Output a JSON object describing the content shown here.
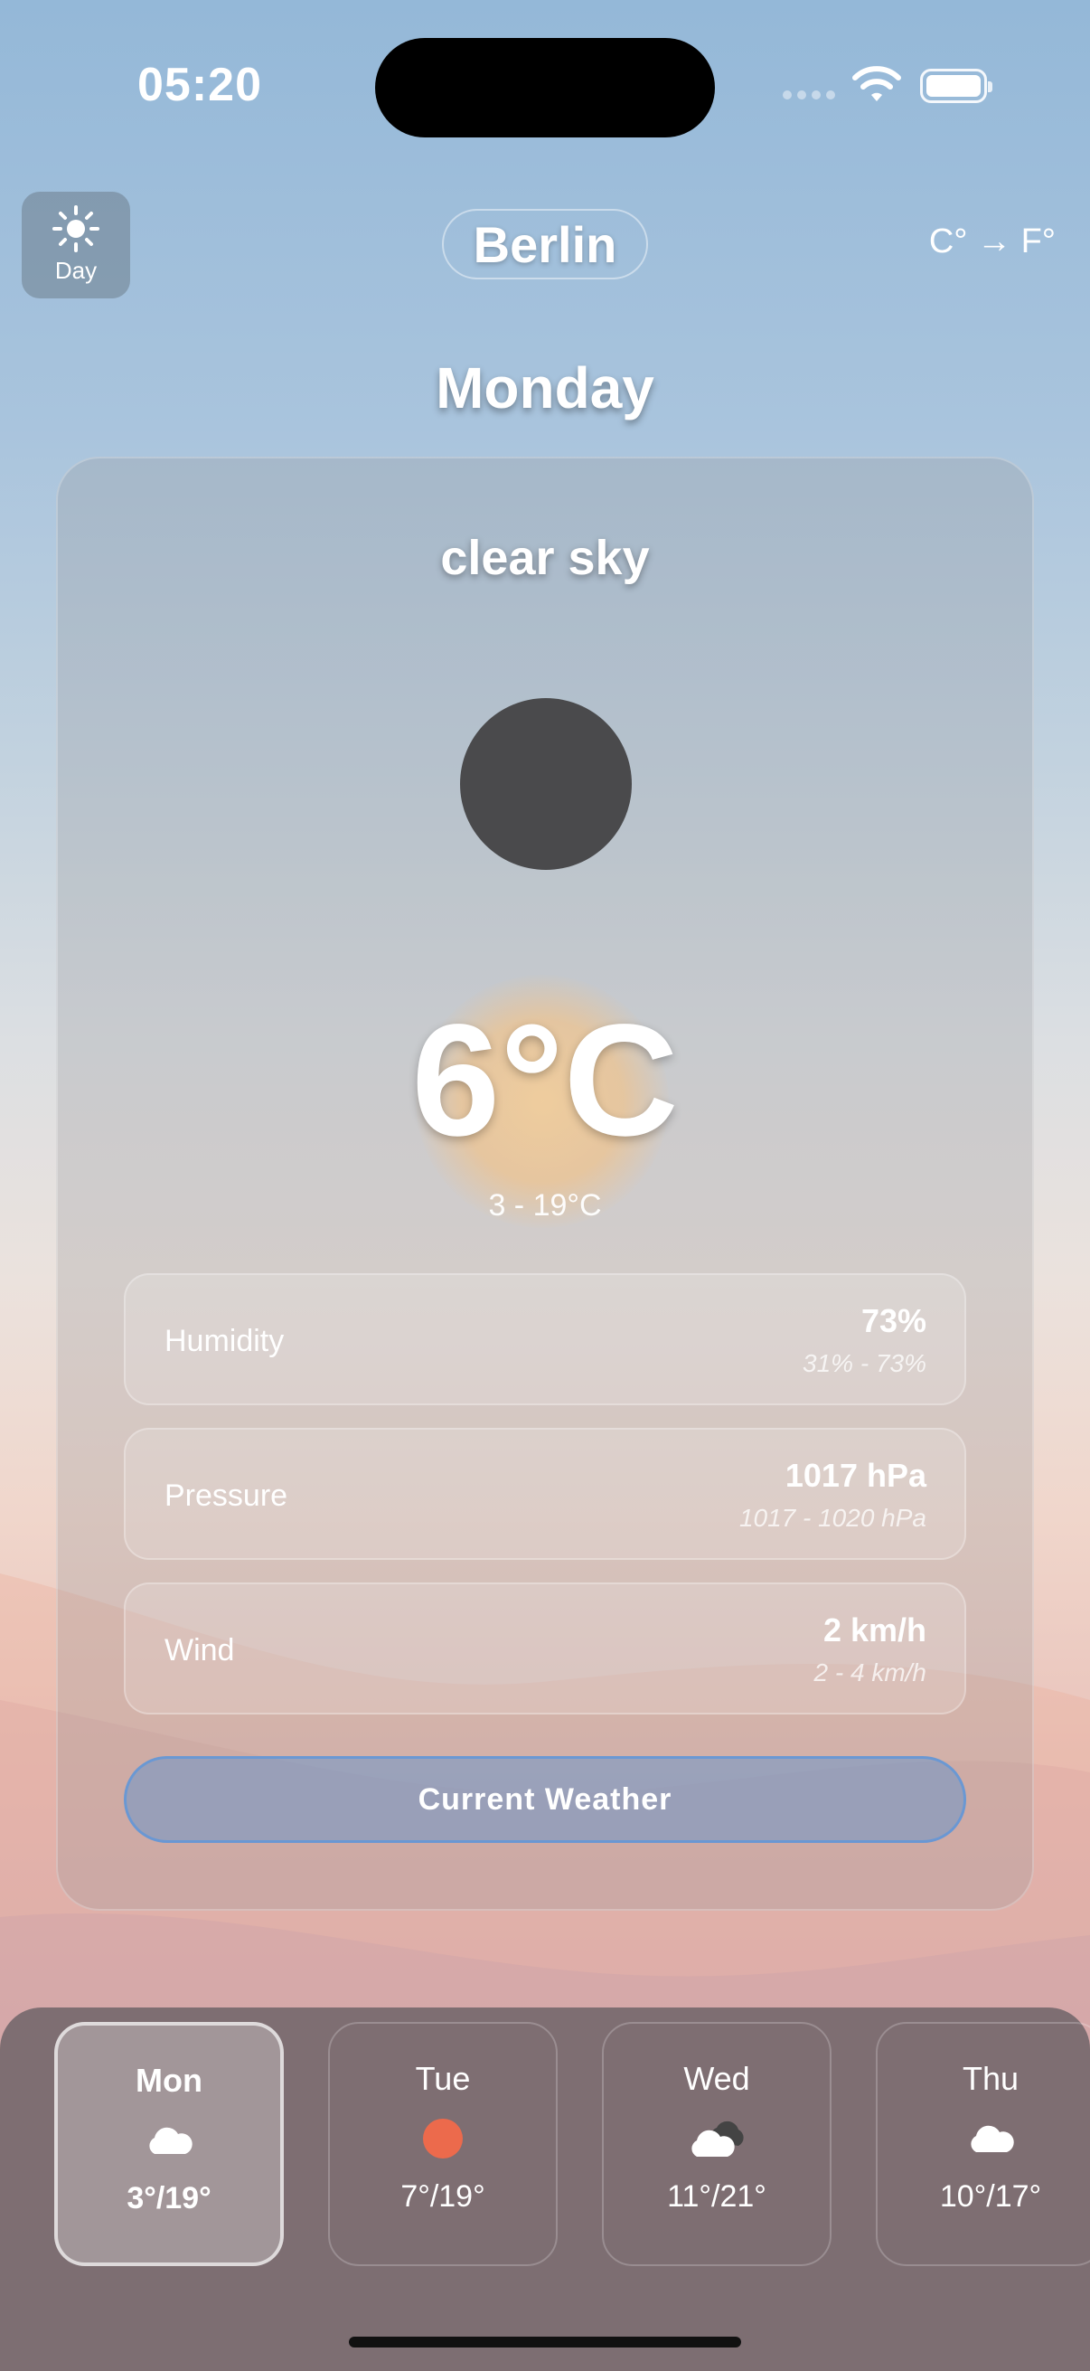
{
  "status_bar": {
    "time": "05:20"
  },
  "header": {
    "mode_label": "Day",
    "city": "Berlin",
    "unit_toggle": "C° → F°"
  },
  "main": {
    "day": "Monday",
    "description": "clear sky",
    "temperature": "6°C",
    "range": "3 - 19°C",
    "stats": [
      {
        "name": "Humidity",
        "value": "73%",
        "range": "31% - 73%"
      },
      {
        "name": "Pressure",
        "value": "1017 hPa",
        "range": "1017 - 1020 hPa"
      },
      {
        "name": "Wind",
        "value": "2 km/h",
        "range": "2 - 4 km/h"
      }
    ],
    "current_button": "Current Weather"
  },
  "forecast": [
    {
      "day": "Mon",
      "icon": "cloud-icon",
      "temps": "3°/19°",
      "selected": true
    },
    {
      "day": "Tue",
      "icon": "sun-icon",
      "temps": "7°/19°",
      "selected": false
    },
    {
      "day": "Wed",
      "icon": "cloudy-icon",
      "temps": "11°/21°",
      "selected": false
    },
    {
      "day": "Thu",
      "icon": "cloud-icon",
      "temps": "10°/17°",
      "selected": false
    }
  ],
  "colors": {
    "sun": "#ec6a4c",
    "moon": "#4a4a4c",
    "button_border": "#5a96dc"
  }
}
